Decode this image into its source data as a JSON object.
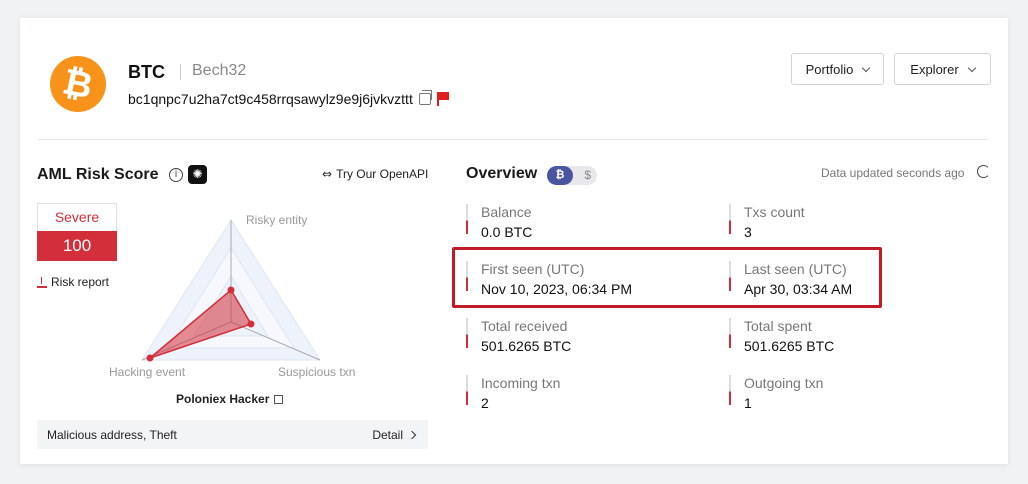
{
  "header": {
    "coin_symbol": "BTC",
    "address_type": "Bech32",
    "address": "bc1qnpc7u2ha7ct9c458rrqsawylz9e9j6jvkvzttt",
    "coin_logo_glyph": "₿",
    "buttons": {
      "portfolio": "Portfolio",
      "explorer": "Explorer"
    }
  },
  "aml": {
    "title": "AML Risk Score",
    "openapi_label": "Try Our OpenAPI",
    "score_level": "Severe",
    "score_value": "100",
    "risk_report_label": "Risk report",
    "radar": {
      "labels": [
        "Risky entity",
        "Suspicious txn",
        "Hacking event"
      ]
    },
    "entity_name": "Poloniex Hacker",
    "tags": "Malicious address, Theft",
    "detail_label": "Detail"
  },
  "overview": {
    "title": "Overview",
    "toggle": {
      "active": "₿",
      "inactive": "$"
    },
    "updated_text": "Data updated seconds ago",
    "stats": [
      {
        "label": "Balance",
        "value": "0.0 BTC"
      },
      {
        "label": "Txs count",
        "value": "3"
      },
      {
        "label": "First seen (UTC)",
        "value": "Nov 10, 2023, 06:34 PM"
      },
      {
        "label": "Last seen (UTC)",
        "value": "Apr 30, 03:34 AM"
      },
      {
        "label": "Total received",
        "value": "501.6265 BTC"
      },
      {
        "label": "Total spent",
        "value": "501.6265 BTC"
      },
      {
        "label": "Incoming txn",
        "value": "2"
      },
      {
        "label": "Outgoing txn",
        "value": "1"
      }
    ]
  },
  "colors": {
    "accent_red": "#d32f3a",
    "btc_orange": "#f7931a",
    "toggle_blue": "#4a55a2"
  }
}
